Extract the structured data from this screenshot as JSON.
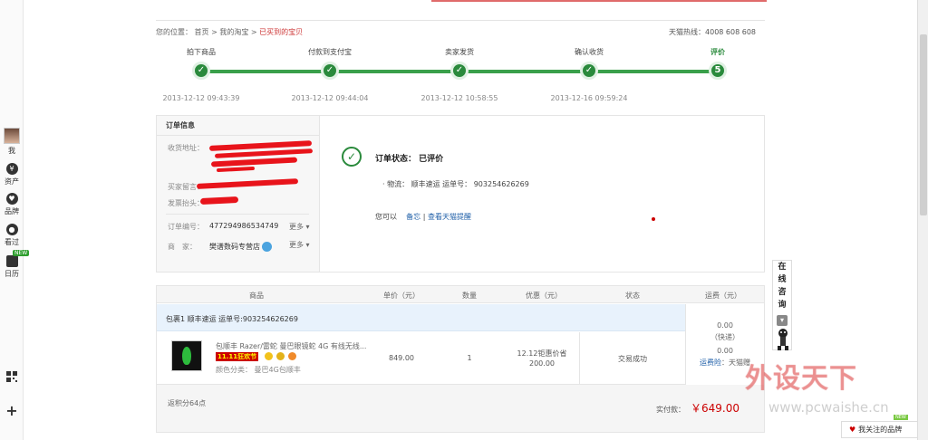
{
  "breadcrumb": {
    "prefix": "您的位置：",
    "home": "首页",
    "sep": ">",
    "mytaobao": "我的淘宝",
    "current": "已买到的宝贝"
  },
  "hotline": "天猫热线：4008 608 608",
  "sidebar": {
    "me": "我",
    "assets": "资产",
    "brand": "品牌",
    "viewed": "看过",
    "calendar": "日历",
    "new_badge": "NEW"
  },
  "steps": [
    {
      "label": "拍下商品",
      "time": "2013-12-12 09:43:39",
      "mark": "✓"
    },
    {
      "label": "付款到支付宝",
      "time": "2013-12-12 09:44:04",
      "mark": "✓"
    },
    {
      "label": "卖家发货",
      "time": "2013-12-12 10:58:55",
      "mark": "✓"
    },
    {
      "label": "确认收货",
      "time": "2013-12-16 09:59:24",
      "mark": "✓"
    },
    {
      "label": "评价",
      "time": "",
      "mark": "5"
    }
  ],
  "order_info": {
    "title": "订单信息",
    "address_label": "收货地址：",
    "message_label": "买家留言：",
    "invoice_label": "发票抬头：",
    "order_no_label": "订单编号：",
    "order_no": "477294986534749",
    "merchant_label": "商　家：",
    "merchant": "樊谱数码专营店",
    "more": "更多 ▾"
  },
  "status": {
    "icon": "✓",
    "text": "订单状态：  已评价",
    "logistics": "物流：  顺丰速运    运单号：  903254626269",
    "you_can": "您可以",
    "memo": "备忘",
    "view_tmall_reminder": "查看天猫提醒"
  },
  "table": {
    "headers": [
      "商品",
      "单价（元）",
      "数量",
      "优惠（元）",
      "状态",
      "运费（元）"
    ],
    "package": "包裹1     顺丰速运    运单号:903254626269",
    "item": {
      "name": "包顺丰 Razer/雷蛇 曼巴眼镜蛇 4G 有线无线...",
      "tag": "11.11狂欢节",
      "category": "颜色分类：  曼巴4G包顺丰",
      "price": "849.00",
      "qty": "1",
      "discount_1": "12.12钜惠价省",
      "discount_2": "200.00",
      "status": "交易成功"
    },
    "shipping": {
      "fee_1": "0.00",
      "fee_1_note": "（快递）",
      "fee_2": "0.00",
      "fee_2_note_link": "运费险",
      "fee_2_note_rest": "：天猫赠"
    },
    "points": "返积分64点",
    "paid_label": "实付款：",
    "paid_amount": "￥649.00"
  },
  "consult": [
    "在",
    "线",
    "咨",
    "询"
  ],
  "watermark": {
    "main": "外设天下",
    "url": "www.pcwaishe.cn"
  },
  "brand_follow": {
    "label": "我关注的品牌",
    "badge": "NEW"
  }
}
